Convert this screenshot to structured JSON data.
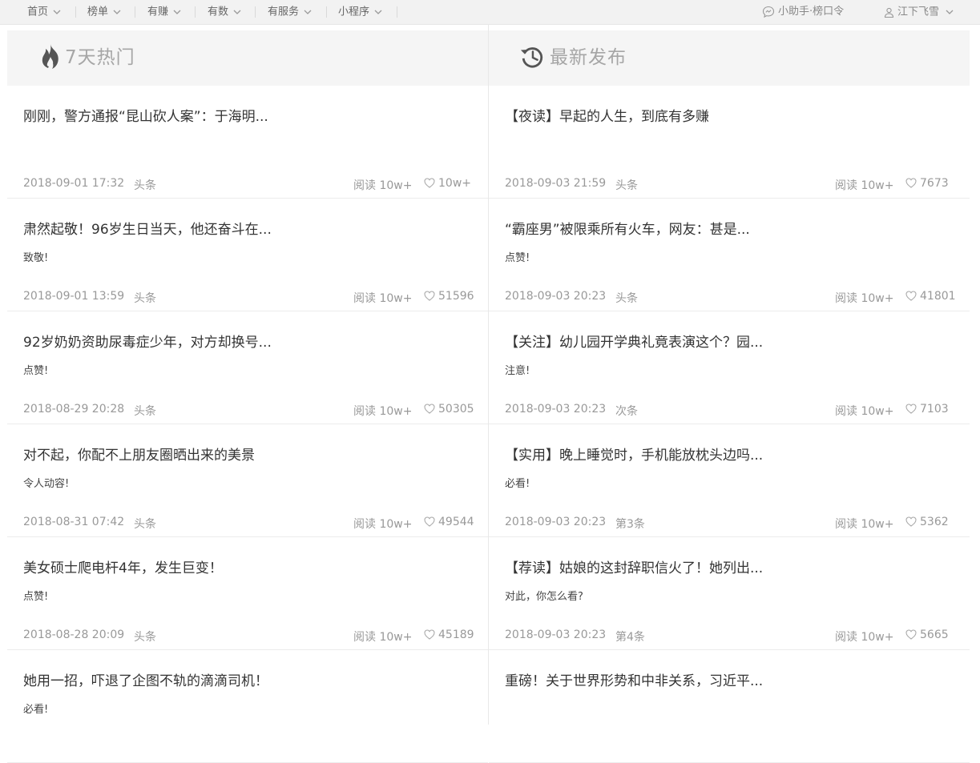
{
  "nav": {
    "items": [
      {
        "label": "首页"
      },
      {
        "label": "榜单"
      },
      {
        "label": "有赚"
      },
      {
        "label": "有数"
      },
      {
        "label": "有服务"
      },
      {
        "label": "小程序"
      }
    ],
    "assistant_label": "小助手·榜口令",
    "user_label": "江下飞雪"
  },
  "left": {
    "title": "7天热门",
    "icon": "flame-icon",
    "items": [
      {
        "title": "刚刚，警方通报“昆山砍人案”：于海明...",
        "sub": "",
        "date": "2018-09-01 17:32",
        "pos": "头条",
        "read": "阅读 10w+",
        "likes": "10w+"
      },
      {
        "title": "肃然起敬！96岁生日当天，他还奋斗在...",
        "sub": "致敬!",
        "date": "2018-09-01 13:59",
        "pos": "头条",
        "read": "阅读 10w+",
        "likes": "51596"
      },
      {
        "title": "92岁奶奶资助尿毒症少年，对方却换号...",
        "sub": "点赞!",
        "date": "2018-08-29 20:28",
        "pos": "头条",
        "read": "阅读 10w+",
        "likes": "50305"
      },
      {
        "title": "对不起，你配不上朋友圈晒出来的美景",
        "sub": "令人动容!",
        "date": "2018-08-31 07:42",
        "pos": "头条",
        "read": "阅读 10w+",
        "likes": "49544"
      },
      {
        "title": "美女硕士爬电杆4年，发生巨变！",
        "sub": "点赞!",
        "date": "2018-08-28 20:09",
        "pos": "头条",
        "read": "阅读 10w+",
        "likes": "45189"
      },
      {
        "title": "她用一招，吓退了企图不轨的滴滴司机！",
        "sub": "必看!",
        "date": "",
        "pos": "",
        "read": "",
        "likes": ""
      }
    ]
  },
  "right": {
    "title": "最新发布",
    "icon": "history-clock-icon",
    "items": [
      {
        "title": "【夜读】早起的人生，到底有多赚",
        "sub": "",
        "date": "2018-09-03 21:59",
        "pos": "头条",
        "read": "阅读 10w+",
        "likes": "7673"
      },
      {
        "title": "“霸座男”被限乘所有火车，网友：甚是...",
        "sub": "点赞!",
        "date": "2018-09-03 20:23",
        "pos": "头条",
        "read": "阅读 10w+",
        "likes": "41801"
      },
      {
        "title": "【关注】幼儿园开学典礼竟表演这个？园...",
        "sub": "注意!",
        "date": "2018-09-03 20:23",
        "pos": "次条",
        "read": "阅读 10w+",
        "likes": "7103"
      },
      {
        "title": "【实用】晚上睡觉时，手机能放枕头边吗...",
        "sub": "必看!",
        "date": "2018-09-03 20:23",
        "pos": "第3条",
        "read": "阅读 10w+",
        "likes": "5362"
      },
      {
        "title": "【荐读】姑娘的这封辞职信火了！她列出...",
        "sub": "对此，你怎么看?",
        "date": "2018-09-03 20:23",
        "pos": "第4条",
        "read": "阅读 10w+",
        "likes": "5665"
      },
      {
        "title": "重磅！关于世界形势和中非关系，习近平...",
        "sub": "",
        "date": "",
        "pos": "",
        "read": "",
        "likes": ""
      }
    ]
  },
  "colors": {
    "topbar_bg": "#f2f2f2",
    "header_bg": "#f5f5f5",
    "muted": "#999999",
    "title_text": "#333333",
    "icon_dark": "#555555"
  }
}
